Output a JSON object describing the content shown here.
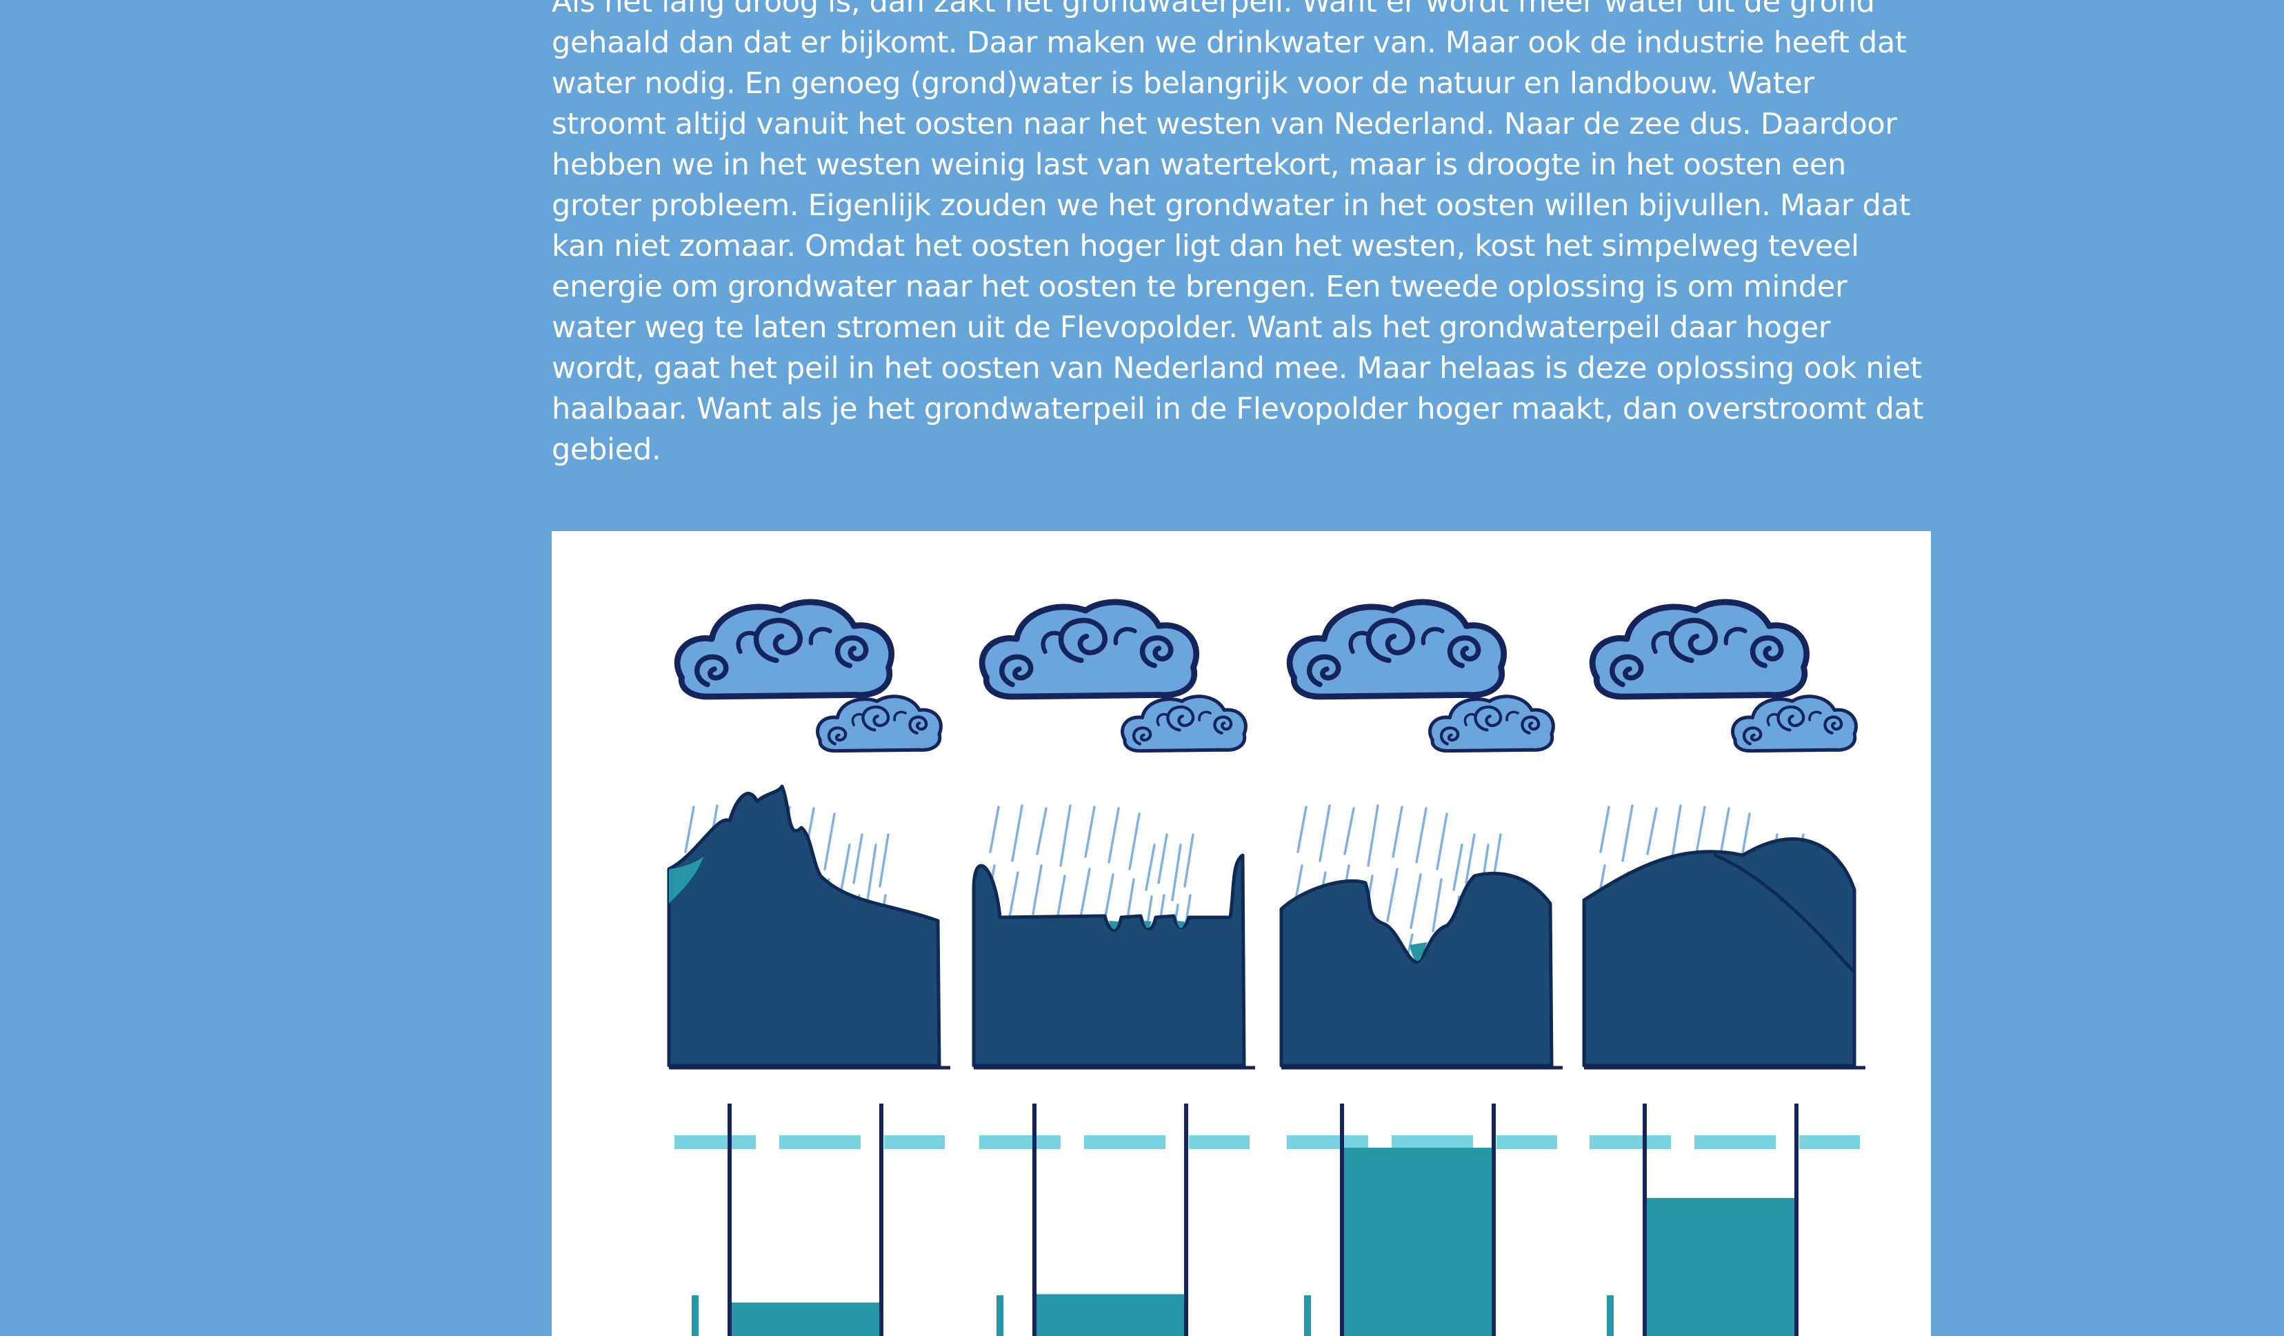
{
  "article": {
    "paragraph": "Als het lang droog is, dan zakt het grondwaterpeil. Want er wordt meer water uit de grond gehaald dan dat er bijkomt. Daar maken we drinkwater van. Maar ook de industrie heeft dat water nodig. En genoeg (grond)water is belangrijk voor de natuur en landbouw. Water stroomt altijd vanuit het oosten naar het westen van Nederland. Naar de zee dus. Daardoor hebben we in het westen weinig last van watertekort, maar is droogte in het oosten een groter probleem. Eigenlijk zouden we het grondwater in het oosten willen bijvullen. Maar dat kan niet zomaar. Omdat het oosten hoger ligt dan het westen, kost het simpelweg teveel energie om grondwater naar het oosten te brengen. Een tweede oplossing is om minder water weg te laten stromen uit de Flevopolder. Want als het grondwaterpeil daar hoger wordt, gaat het peil in het oosten van Nederland mee. Maar helaas is deze oplossing ook niet haalbaar. Want als je het grondwaterpeil in de Flevopolder hoger maakt, dan overstroomt dat gebied."
  },
  "illustration": {
    "colors": {
      "page_background": "#66a5d9",
      "panel_background": "#ffffff",
      "cloud_fill": "#6aa6dd",
      "cloud_outline": "#16245c",
      "rain": "#7fb2e2",
      "land": "#1b4a74",
      "land_outline": "#0f2a55",
      "water": "#2597a6",
      "dashed_reference": "#78d3e1",
      "tube_outline": "#16245c"
    },
    "icons": [
      "cloud-icon",
      "rain-icon",
      "land-profile-icon",
      "water-tube-icon"
    ],
    "scenes": [
      {
        "landscape": "hills",
        "tube_water_level": 0.08
      },
      {
        "landscape": "flat-with-ditches",
        "tube_water_level": 0.1
      },
      {
        "landscape": "valley",
        "tube_water_level": 0.45
      },
      {
        "landscape": "slope",
        "tube_water_level": 0.33
      }
    ]
  }
}
